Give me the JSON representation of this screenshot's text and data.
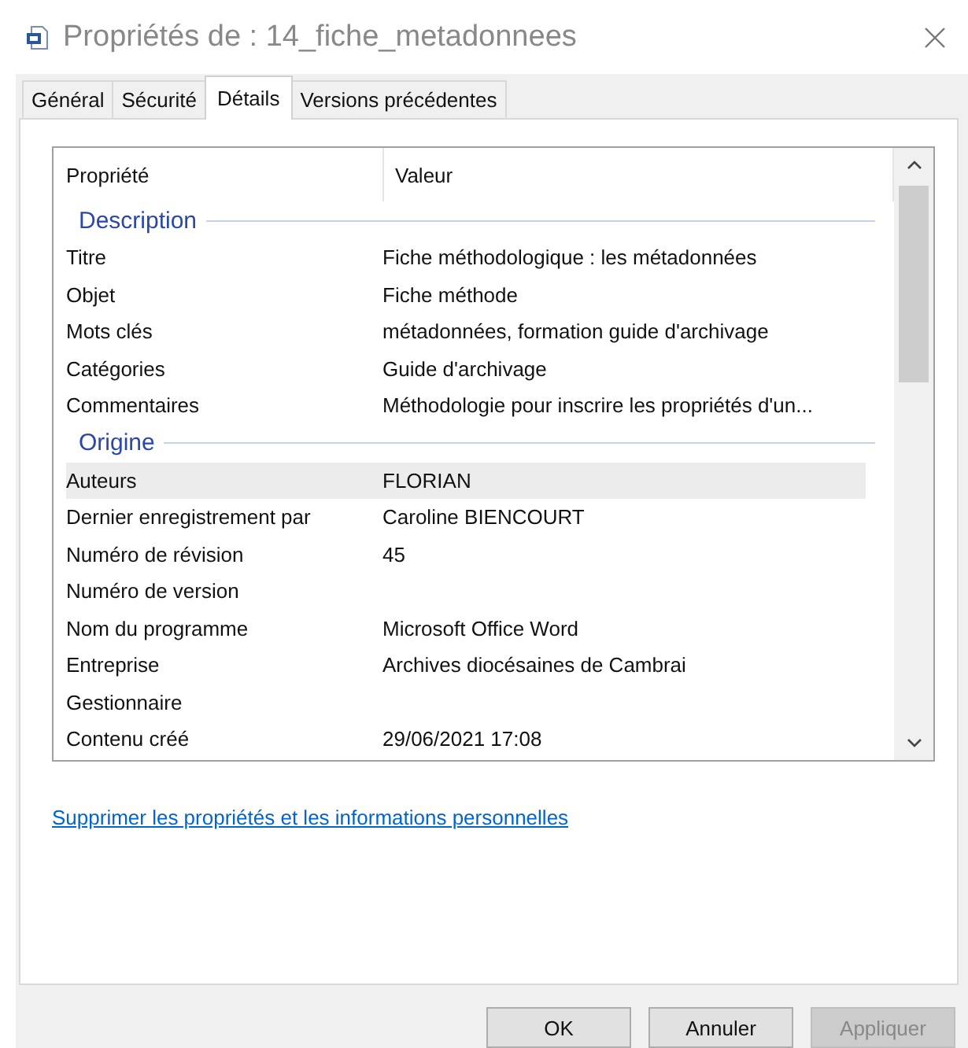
{
  "window": {
    "title": "Propriétés de : 14_fiche_metadonnees"
  },
  "tabs": [
    {
      "label": "Général",
      "selected": false
    },
    {
      "label": "Sécurité",
      "selected": false
    },
    {
      "label": "Détails",
      "selected": true
    },
    {
      "label": "Versions précédentes",
      "selected": false
    }
  ],
  "table": {
    "columns": [
      "Propriété",
      "Valeur"
    ],
    "groups": [
      {
        "title": "Description",
        "rows": [
          {
            "property": "Titre",
            "value": "Fiche méthodologique : les métadonnées",
            "selected": false
          },
          {
            "property": "Objet",
            "value": "Fiche méthode",
            "selected": false
          },
          {
            "property": "Mots clés",
            "value": "métadonnées, formation guide d'archivage",
            "selected": false
          },
          {
            "property": "Catégories",
            "value": "Guide d'archivage",
            "selected": false
          },
          {
            "property": "Commentaires",
            "value": "Méthodologie pour inscrire les propriétés d'un...",
            "selected": false
          }
        ]
      },
      {
        "title": "Origine",
        "rows": [
          {
            "property": "Auteurs",
            "value": "FLORIAN",
            "selected": true
          },
          {
            "property": "Dernier enregistrement par",
            "value": "Caroline BIENCOURT",
            "selected": false
          },
          {
            "property": "Numéro de révision",
            "value": "45",
            "selected": false
          },
          {
            "property": "Numéro de version",
            "selected": false
          },
          {
            "property": "Nom du programme",
            "value": "Microsoft Office Word",
            "selected": false
          },
          {
            "property": "Entreprise",
            "value": "Archives diocésaines de Cambrai",
            "selected": false
          },
          {
            "property": "Gestionnaire",
            "selected": false
          },
          {
            "property": "Contenu créé",
            "value": "29/06/2021 17:08",
            "selected": false
          }
        ]
      }
    ]
  },
  "link": "Supprimer les propriétés et les informations personnelles",
  "buttons": [
    {
      "label": "OK",
      "disabled": false
    },
    {
      "label": "Annuler",
      "disabled": false
    },
    {
      "label": "Appliquer",
      "disabled": true
    }
  ]
}
